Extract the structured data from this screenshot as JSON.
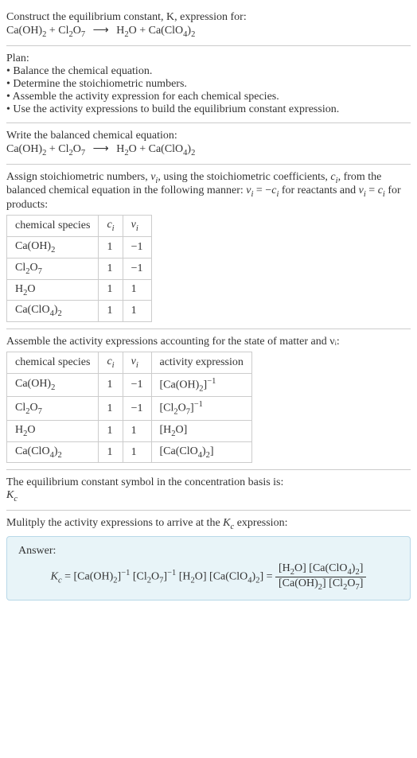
{
  "intro": {
    "line1": "Construct the equilibrium constant, K, expression for:",
    "equation_lhs1": "Ca(OH)",
    "equation_lhs1_sub": "2",
    "plus": " + ",
    "equation_lhs2": "Cl",
    "equation_lhs2_sub": "2",
    "equation_lhs2b": "O",
    "equation_lhs2b_sub": "7",
    "arrow": "⟶",
    "equation_rhs1": "H",
    "equation_rhs1_sub": "2",
    "equation_rhs1b": "O",
    "equation_rhs2": "Ca(ClO",
    "equation_rhs2_sub": "4",
    "equation_rhs2b": ")",
    "equation_rhs2b_sub": "2"
  },
  "plan": {
    "title": "Plan:",
    "items": [
      "Balance the chemical equation.",
      "Determine the stoichiometric numbers.",
      "Assemble the activity expression for each chemical species.",
      "Use the activity expressions to build the equilibrium constant expression."
    ]
  },
  "balanced": {
    "title": "Write the balanced chemical equation:"
  },
  "stoich_text": {
    "part1": "Assign stoichiometric numbers, ",
    "nu": "ν",
    "sub_i": "i",
    "part2": ", using the stoichiometric coefficients, ",
    "c": "c",
    "part3": ", from the balanced chemical equation in the following manner: ",
    "eq1": " = −",
    "part4": " for reactants and ",
    "eq2": " = ",
    "part5": " for products:"
  },
  "table1": {
    "headers": [
      "chemical species",
      "cᵢ",
      "νᵢ"
    ],
    "rows": [
      {
        "species": "Ca(OH)₂",
        "ci": "1",
        "nui": "−1"
      },
      {
        "species": "Cl₂O₇",
        "ci": "1",
        "nui": "−1"
      },
      {
        "species": "H₂O",
        "ci": "1",
        "nui": "1"
      },
      {
        "species": "Ca(ClO₄)₂",
        "ci": "1",
        "nui": "1"
      }
    ]
  },
  "activity_text": "Assemble the activity expressions accounting for the state of matter and νᵢ:",
  "table2": {
    "headers": [
      "chemical species",
      "cᵢ",
      "νᵢ",
      "activity expression"
    ],
    "rows": [
      {
        "species": "Ca(OH)₂",
        "ci": "1",
        "nui": "−1",
        "expr": "[Ca(OH)₂]⁻¹"
      },
      {
        "species": "Cl₂O₇",
        "ci": "1",
        "nui": "−1",
        "expr": "[Cl₂O₇]⁻¹"
      },
      {
        "species": "H₂O",
        "ci": "1",
        "nui": "1",
        "expr": "[H₂O]"
      },
      {
        "species": "Ca(ClO₄)₂",
        "ci": "1",
        "nui": "1",
        "expr": "[Ca(ClO₄)₂]"
      }
    ]
  },
  "eq_symbol": {
    "line1": "The equilibrium constant symbol in the concentration basis is:",
    "symbol": "K",
    "sub": "c"
  },
  "multiply": {
    "text": "Mulitply the activity expressions to arrive at the ",
    "k": "K",
    "sub": "c",
    "text2": " expression:"
  },
  "answer": {
    "label": "Answer:",
    "kc": "K",
    "kc_sub": "c",
    "eq": " = [Ca(OH)",
    "s1": "2",
    "p1": "]",
    "e1": "−1",
    "p2": " [Cl",
    "s2": "2",
    "p3": "O",
    "s3": "7",
    "p4": "]",
    "e2": "−1",
    "p5": " [H",
    "s4": "2",
    "p6": "O] [Ca(ClO",
    "s5": "4",
    "p7": ")",
    "s6": "2",
    "p8": "] = ",
    "num1": "[H",
    "num_s1": "2",
    "num2": "O] [Ca(ClO",
    "num_s2": "4",
    "num3": ")",
    "num_s3": "2",
    "num4": "]",
    "den1": "[Ca(OH)",
    "den_s1": "2",
    "den2": "] [Cl",
    "den_s2": "2",
    "den3": "O",
    "den_s3": "7",
    "den4": "]"
  }
}
